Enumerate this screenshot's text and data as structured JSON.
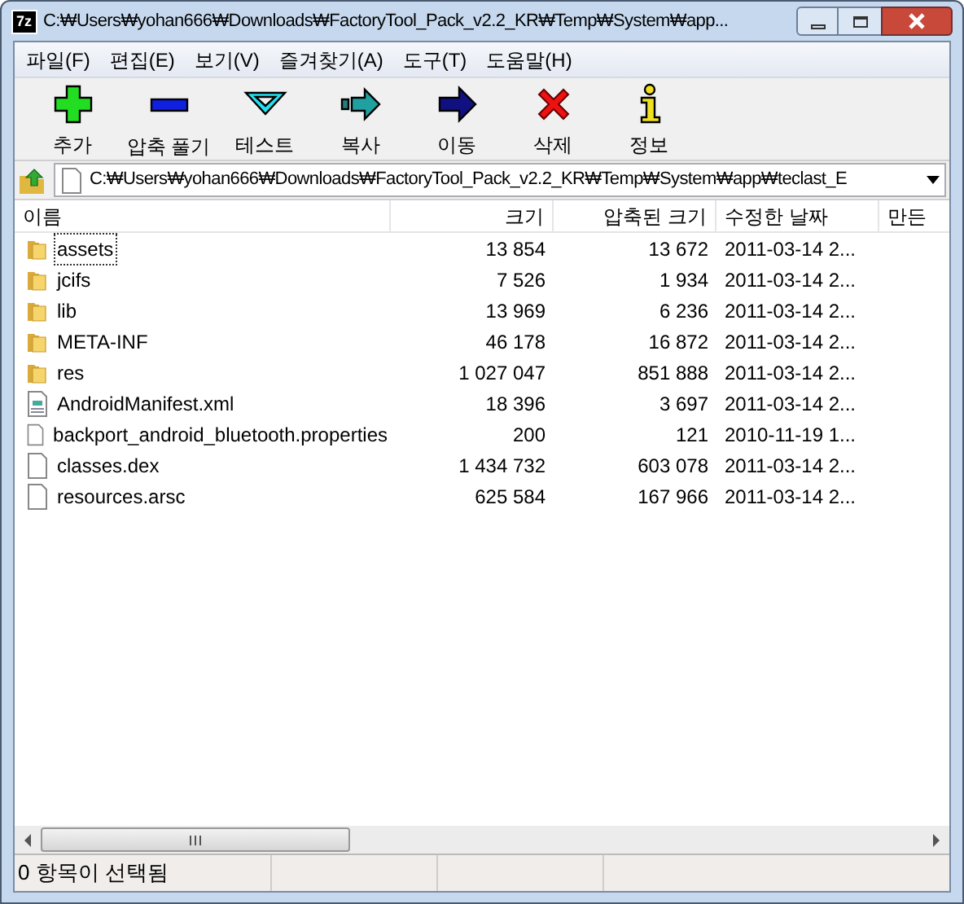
{
  "window": {
    "title": "C:₩Users₩yohan666₩Downloads₩FactoryTool_Pack_v2.2_KR₩Temp₩System₩app...",
    "app_icon": "7z"
  },
  "menu": [
    "파일(F)",
    "편집(E)",
    "보기(V)",
    "즐겨찾기(A)",
    "도구(T)",
    "도움말(H)"
  ],
  "toolbar": [
    {
      "kind": "add",
      "label": "추가"
    },
    {
      "kind": "extract",
      "label": "압축 풀기"
    },
    {
      "kind": "test",
      "label": "테스트"
    },
    {
      "kind": "copy",
      "label": "복사"
    },
    {
      "kind": "move",
      "label": "이동"
    },
    {
      "kind": "delete",
      "label": "삭제"
    },
    {
      "kind": "info",
      "label": "정보"
    }
  ],
  "address": {
    "value": "C:₩Users₩yohan666₩Downloads₩FactoryTool_Pack_v2.2_KR₩Temp₩System₩app₩teclast_E"
  },
  "table": {
    "columns": [
      "이름",
      "크기",
      "압축된 크기",
      "수정한 날짜",
      "만든"
    ],
    "rows": [
      {
        "kind": "folder",
        "name": "assets",
        "size": "13 854",
        "packed": "13 672",
        "modified": "2011-03-14 2...",
        "focused": true
      },
      {
        "kind": "folder",
        "name": "jcifs",
        "size": "7 526",
        "packed": "1 934",
        "modified": "2011-03-14 2...",
        "focused": false
      },
      {
        "kind": "folder",
        "name": "lib",
        "size": "13 969",
        "packed": "6 236",
        "modified": "2011-03-14 2...",
        "focused": false
      },
      {
        "kind": "folder",
        "name": "META-INF",
        "size": "46 178",
        "packed": "16 872",
        "modified": "2011-03-14 2...",
        "focused": false
      },
      {
        "kind": "folder",
        "name": "res",
        "size": "1 027 047",
        "packed": "851 888",
        "modified": "2011-03-14 2...",
        "focused": false
      },
      {
        "kind": "xml",
        "name": "AndroidManifest.xml",
        "size": "18 396",
        "packed": "3 697",
        "modified": "2011-03-14 2...",
        "focused": false
      },
      {
        "kind": "file",
        "name": "backport_android_bluetooth.properties",
        "size": "200",
        "packed": "121",
        "modified": "2010-11-19 1...",
        "focused": false
      },
      {
        "kind": "file",
        "name": "classes.dex",
        "size": "1 434 732",
        "packed": "603 078",
        "modified": "2011-03-14 2...",
        "focused": false
      },
      {
        "kind": "file",
        "name": "resources.arsc",
        "size": "625 584",
        "packed": "167 966",
        "modified": "2011-03-14 2...",
        "focused": false
      }
    ]
  },
  "status_bar": {
    "text": "0 항목이 선택됨"
  }
}
